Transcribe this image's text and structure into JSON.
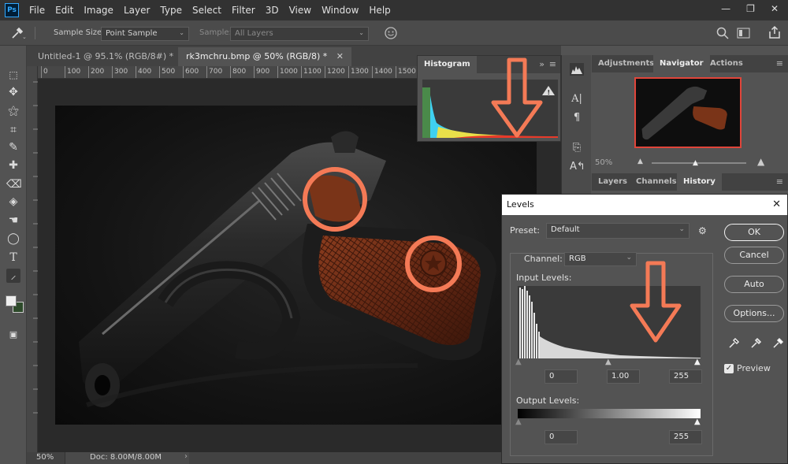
{
  "menubar": {
    "logo": "Ps",
    "items": [
      "File",
      "Edit",
      "Image",
      "Layer",
      "Type",
      "Select",
      "Filter",
      "3D",
      "View",
      "Window",
      "Help"
    ],
    "window_controls": [
      "—",
      "❐",
      "✕"
    ]
  },
  "options_bar": {
    "sample_size_label": "Sample Size:",
    "sample_size_value": "Point Sample",
    "sample_label": "Sample:",
    "sample_value": "All Layers"
  },
  "document_tabs": [
    {
      "label": "Untitled-1 @ 95.1% (RGB/8#) *",
      "active": false
    },
    {
      "label": "rk3mchru.bmp @ 50% (RGB/8) *",
      "active": true
    }
  ],
  "ruler": {
    "ticks": [
      "0",
      "100",
      "200",
      "300",
      "400",
      "500",
      "600",
      "700",
      "800",
      "900",
      "1000",
      "1100",
      "1200",
      "1300",
      "1400",
      "1500"
    ]
  },
  "status_bar": {
    "zoom": "50%",
    "doc_info": "Doc: 8.00M/8.00M"
  },
  "histogram_panel": {
    "tab": "Histogram",
    "warning_icon": "warning-icon"
  },
  "navigator_panel": {
    "tabs": [
      "Adjustments",
      "Navigator",
      "Actions"
    ],
    "active_tab": "Navigator",
    "zoom": "50%"
  },
  "layers_panel": {
    "tabs": [
      "Layers",
      "Channels",
      "History"
    ],
    "active_tab": "History"
  },
  "levels_dialog": {
    "title": "Levels",
    "preset_label": "Preset:",
    "preset_value": "Default",
    "channel_label": "Channel:",
    "channel_value": "RGB",
    "input_levels_label": "Input Levels:",
    "input_black": "0",
    "input_gamma": "1.00",
    "input_white": "255",
    "output_levels_label": "Output Levels:",
    "output_black": "0",
    "output_white": "255",
    "buttons": {
      "ok": "OK",
      "cancel": "Cancel",
      "auto": "Auto",
      "options": "Options..."
    },
    "preview_label": "Preview",
    "preview_checked": true
  },
  "colors": {
    "annotation": "#f47a56",
    "menubar_bg": "#323232",
    "panel_bg": "#535353",
    "accent_blue": "#31a8ff"
  }
}
